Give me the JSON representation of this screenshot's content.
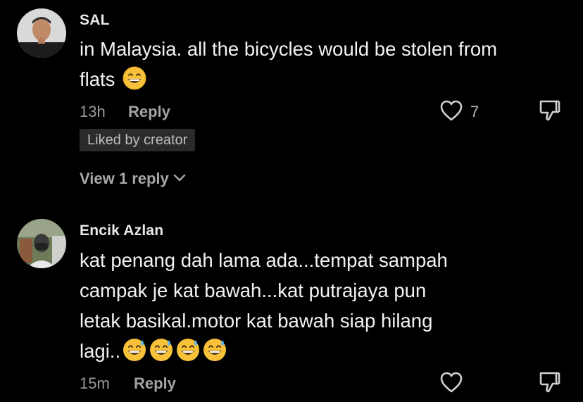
{
  "comments": [
    {
      "username": "SAL",
      "text": "in Malaysia. all the bicycles would be stolen from flats",
      "emojis": [
        "grinning-face-with-smiling-eyes"
      ],
      "time": "13h",
      "reply_label": "Reply",
      "like_count": "7",
      "badge": "Liked by creator",
      "view_replies": "View 1 reply"
    },
    {
      "username": "Encik Azlan",
      "text_lines": [
        "kat penang dah lama ada...tempat sampah",
        "campak je kat bawah...kat putrajaya pun",
        "letak basikal.motor kat bawah siap hilang",
        "lagi.."
      ],
      "emojis": [
        "grinning-face-with-sweat",
        "grinning-face-with-sweat",
        "grinning-face-with-sweat",
        "grinning-face-with-sweat"
      ],
      "time": "15m",
      "reply_label": "Reply"
    }
  ],
  "colors": {
    "background": "#000000",
    "text": "#f2f2f2",
    "muted": "#9a9a9a",
    "badge_bg": "#2b2b2b"
  },
  "icons": [
    "heart-outline-icon",
    "thumbs-down-icon",
    "chevron-down-icon"
  ]
}
